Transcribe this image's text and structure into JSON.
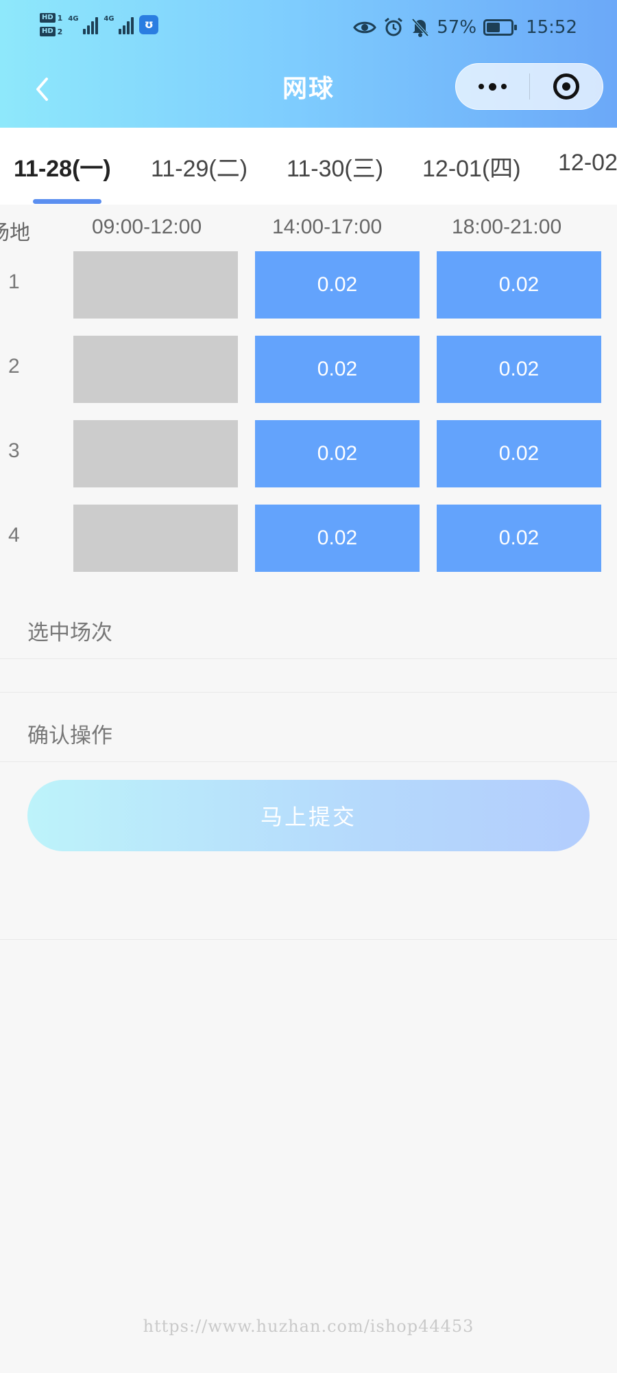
{
  "status_bar": {
    "hd1": "HD",
    "hd1_num": "1",
    "hd2": "HD",
    "hd2_num": "2",
    "net1": "4G",
    "net2": "4G",
    "battery": "57%",
    "battery_level": 0.57,
    "time": "15:52"
  },
  "nav": {
    "title": "网球"
  },
  "date_tabs": [
    {
      "label": "11-28(一)",
      "active": true
    },
    {
      "label": "11-29(二)",
      "active": false
    },
    {
      "label": "11-30(三)",
      "active": false
    },
    {
      "label": "12-01(四)",
      "active": false
    },
    {
      "label": "12-02",
      "active": false
    }
  ],
  "grid": {
    "venue_header": "场地",
    "time_slots": [
      "09:00-12:00",
      "14:00-17:00",
      "18:00-21:00"
    ],
    "rows": [
      {
        "label": "1",
        "cells": [
          "",
          "0.02",
          "0.02"
        ]
      },
      {
        "label": "2",
        "cells": [
          "",
          "0.02",
          "0.02"
        ]
      },
      {
        "label": "3",
        "cells": [
          "",
          "0.02",
          "0.02"
        ]
      },
      {
        "label": "4",
        "cells": [
          "",
          "0.02",
          "0.02"
        ]
      }
    ]
  },
  "sections": {
    "selected_label": "选中场次",
    "confirm_label": "确认操作",
    "submit_label": "马上提交"
  },
  "watermark": "https://www.huzhan.com/ishop44453",
  "colors": {
    "available": "#63a3fc",
    "disabled": "#cccccc",
    "header_start": "#8ee8fb",
    "header_end": "#6ba8f8"
  }
}
